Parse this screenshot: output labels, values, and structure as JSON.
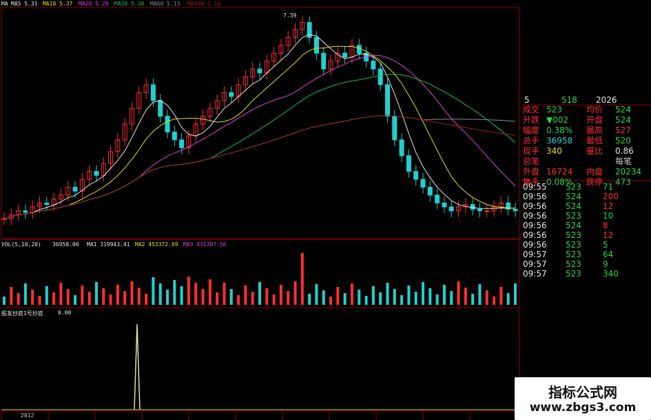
{
  "colors": {
    "bg": "#000000",
    "up": "#ff3030",
    "down": "#20d0d0",
    "grid": "#8b0000",
    "ma5": "#e8e8e8",
    "ma10": "#e8e020",
    "ma20": "#e040e0",
    "ma30": "#20c040",
    "ma60": "#8090a0",
    "ma120": "#a02020"
  },
  "top_legend": {
    "ma": "MA",
    "ma5": "MA5 5.31",
    "ma10": "MA10 5.37",
    "ma20": "MA20 5.29",
    "ma30": "MA30 5.20",
    "ma60": "MA60 5.13",
    "ma120": "MA120 5.10"
  },
  "peak_label": "7.39",
  "volume_legend": {
    "title": "VOL(5,10,20)",
    "vol": "36958.00",
    "ma1": "MA1 319943.41",
    "ma2": "MA2 453372.69",
    "ma3": "MA3 431707.56"
  },
  "indicator_legend": {
    "title": "股友抄底1号抄底",
    "value": "0.00"
  },
  "year_label": "2012",
  "quote": {
    "header": {
      "n": "5",
      "mid": "518",
      "right": "2026"
    },
    "rows": [
      {
        "l": "成交",
        "v": "523",
        "r": "均价",
        "rv": "524"
      },
      {
        "l": "升跌",
        "v": "▼002",
        "r": "开盘",
        "rv": "524"
      },
      {
        "l": "幅度",
        "v": "0.38%",
        "r": "最高",
        "rv": "527"
      },
      {
        "l": "总手",
        "v": "36958",
        "r": "最低",
        "rv": "520"
      },
      {
        "l": "现手",
        "v": "340",
        "r": "量比",
        "rv": "0.86"
      },
      {
        "l": "总笔",
        "v": "",
        "r": "",
        "rv": "每笔"
      },
      {
        "l": "外盘",
        "v": "16724",
        "r": "内盘",
        "rv": "20234"
      },
      {
        "l": "换手",
        "v": "0.08%",
        "r": "跌停",
        "rv": "473"
      }
    ],
    "ticks": [
      {
        "t": "09:55",
        "p": "523",
        "v": "71"
      },
      {
        "t": "09:56",
        "p": "524",
        "v": "200"
      },
      {
        "t": "09:56",
        "p": "524",
        "v": "12"
      },
      {
        "t": "09:56",
        "p": "523",
        "v": "10"
      },
      {
        "t": "09:56",
        "p": "524",
        "v": "8"
      },
      {
        "t": "09:56",
        "p": "523",
        "v": "12"
      },
      {
        "t": "09:56",
        "p": "523",
        "v": "5"
      },
      {
        "t": "09:57",
        "p": "523",
        "v": "64"
      },
      {
        "t": "09:57",
        "p": "523",
        "v": "9"
      },
      {
        "t": "09:57",
        "p": "523",
        "v": "340"
      }
    ]
  },
  "chart_data": {
    "type": "candlestick",
    "closes": [
      4.9,
      4.95,
      5.0,
      4.98,
      5.05,
      5.1,
      5.08,
      5.15,
      5.2,
      5.3,
      5.25,
      5.4,
      5.5,
      5.45,
      5.6,
      5.75,
      5.9,
      6.1,
      6.3,
      6.5,
      6.6,
      6.4,
      6.2,
      6.0,
      5.9,
      5.8,
      5.95,
      6.1,
      6.2,
      6.3,
      6.4,
      6.5,
      6.45,
      6.6,
      6.7,
      6.8,
      6.75,
      6.9,
      7.0,
      7.1,
      7.2,
      7.3,
      7.39,
      7.2,
      7.0,
      6.8,
      6.9,
      7.0,
      6.95,
      7.1,
      7.0,
      6.9,
      6.8,
      6.6,
      6.2,
      5.9,
      5.7,
      5.5,
      5.4,
      5.3,
      5.2,
      5.1,
      5.05,
      5.0,
      5.05,
      5.08,
      5.02,
      5.0,
      5.0,
      5.05,
      5.1,
      5.02,
      5.0
    ]
  }
}
